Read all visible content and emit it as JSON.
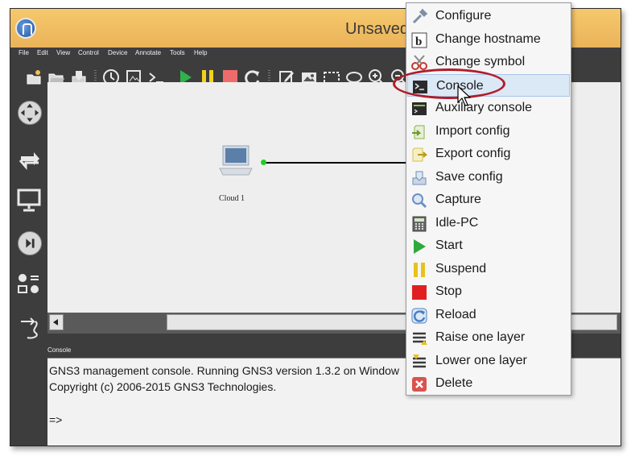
{
  "window": {
    "title": "Unsaved"
  },
  "menubar": {
    "items": [
      "File",
      "Edit",
      "View",
      "Control",
      "Device",
      "Annotate",
      "Tools",
      "Help"
    ]
  },
  "toolbar": {
    "icons": [
      "new-project-icon",
      "open-folder-icon",
      "save-icon",
      "clock-icon",
      "snapshot-icon",
      "terminal-icon",
      "play-icon",
      "pause-icon",
      "stop-icon",
      "reload-icon",
      "note-icon",
      "image-icon",
      "rectangle-icon",
      "ellipse-icon",
      "zoom-in-icon",
      "zoom-out-icon"
    ]
  },
  "dock": {
    "icons": [
      "routers-icon",
      "switches-icon",
      "end-devices-icon",
      "security-devices-icon",
      "all-devices-icon",
      "add-link-icon"
    ]
  },
  "canvas": {
    "node_label": "Cloud 1"
  },
  "context_menu": {
    "items": [
      {
        "label": "Configure",
        "icon": "configure-icon",
        "color": "#7d8fa3"
      },
      {
        "label": "Change hostname",
        "icon": "hostname-icon",
        "color": "#444444"
      },
      {
        "label": "Change symbol",
        "icon": "symbol-icon",
        "color": "#c0392b"
      },
      {
        "label": "Console",
        "icon": "console-icon",
        "color": "#2b2b2b",
        "highlighted": true
      },
      {
        "label": "Auxiliary console",
        "icon": "aux-console-icon",
        "color": "#2b2b2b"
      },
      {
        "label": "Import config",
        "icon": "import-config-icon",
        "color": "#8ab04a"
      },
      {
        "label": "Export config",
        "icon": "export-config-icon",
        "color": "#d8c24a"
      },
      {
        "label": "Save config",
        "icon": "save-config-icon",
        "color": "#6f8fb5"
      },
      {
        "label": "Capture",
        "icon": "capture-icon",
        "color": "#6b8fc7"
      },
      {
        "label": "Idle-PC",
        "icon": "idle-pc-icon",
        "color": "#555555"
      },
      {
        "label": "Start",
        "icon": "start-icon",
        "color": "#2eaa3d"
      },
      {
        "label": "Suspend",
        "icon": "suspend-icon",
        "color": "#e8c21a"
      },
      {
        "label": "Stop",
        "icon": "stop-icon",
        "color": "#e02020"
      },
      {
        "label": "Reload",
        "icon": "reload-icon",
        "color": "#4a7fc0"
      },
      {
        "label": "Raise one layer",
        "icon": "raise-layer-icon",
        "color": "#3a3a3a"
      },
      {
        "label": "Lower one layer",
        "icon": "lower-layer-icon",
        "color": "#3a3a3a"
      },
      {
        "label": "Delete",
        "icon": "delete-icon",
        "color": "#d9534f"
      }
    ]
  },
  "console": {
    "title": "Console",
    "lines": [
      "GNS3 management console. Running GNS3 version 1.3.2 on Window",
      "Copyright (c) 2006-2015 GNS3 Technologies.",
      "",
      "=>"
    ]
  }
}
